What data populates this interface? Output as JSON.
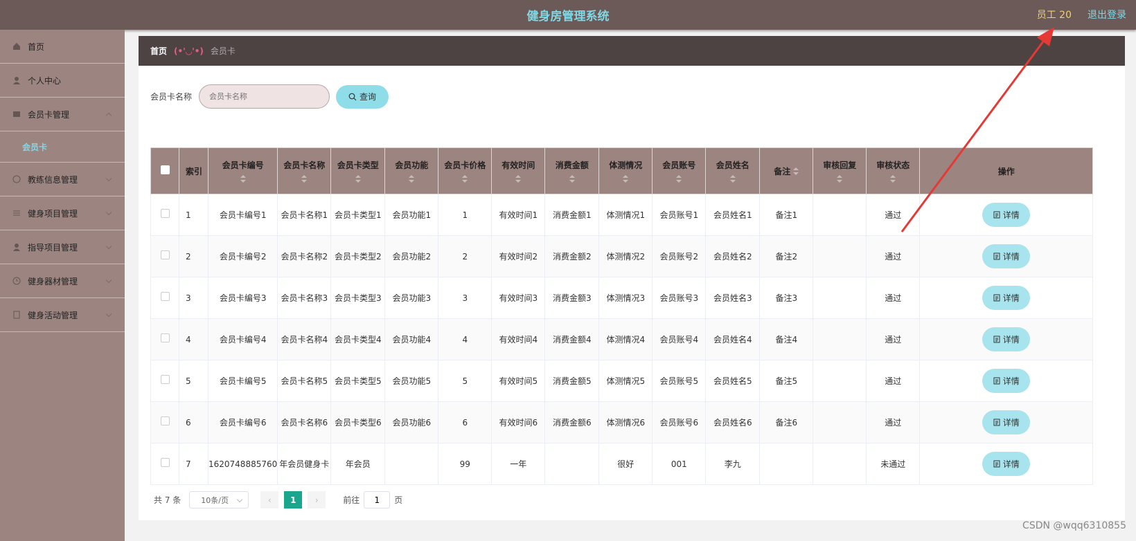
{
  "header": {
    "title": "健身房管理系统",
    "user": "员工 20",
    "logout": "退出登录"
  },
  "sidebar": {
    "items": [
      {
        "label": "首页",
        "icon": "home-icon"
      },
      {
        "label": "个人中心",
        "icon": "user-icon"
      },
      {
        "label": "会员卡管理",
        "icon": "card-icon",
        "open": true,
        "sub": [
          "会员卡"
        ]
      },
      {
        "label": "教练信息管理",
        "icon": "info-icon"
      },
      {
        "label": "健身项目管理",
        "icon": "list-icon"
      },
      {
        "label": "指导项目管理",
        "icon": "user-icon"
      },
      {
        "label": "健身器材管理",
        "icon": "clock-icon"
      },
      {
        "label": "健身活动管理",
        "icon": "doc-icon"
      }
    ]
  },
  "breadcrumb": {
    "home": "首页",
    "face": "(•'◡'•)",
    "current": "会员卡"
  },
  "search": {
    "label": "会员卡名称",
    "placeholder": "会员卡名称",
    "button": "查询"
  },
  "table": {
    "headers": [
      "索引",
      "会员卡编号",
      "会员卡名称",
      "会员卡类型",
      "会员功能",
      "会员卡价格",
      "有效时间",
      "消费金额",
      "体测情况",
      "会员账号",
      "会员姓名",
      "备注",
      "审核回复",
      "审核状态",
      "操作"
    ],
    "rows": [
      [
        "1",
        "会员卡编号1",
        "会员卡名称1",
        "会员卡类型1",
        "会员功能1",
        "1",
        "有效时间1",
        "消费金额1",
        "体测情况1",
        "会员账号1",
        "会员姓名1",
        "备注1",
        "",
        "通过"
      ],
      [
        "2",
        "会员卡编号2",
        "会员卡名称2",
        "会员卡类型2",
        "会员功能2",
        "2",
        "有效时间2",
        "消费金额2",
        "体测情况2",
        "会员账号2",
        "会员姓名2",
        "备注2",
        "",
        "通过"
      ],
      [
        "3",
        "会员卡编号3",
        "会员卡名称3",
        "会员卡类型3",
        "会员功能3",
        "3",
        "有效时间3",
        "消费金额3",
        "体测情况3",
        "会员账号3",
        "会员姓名3",
        "备注3",
        "",
        "通过"
      ],
      [
        "4",
        "会员卡编号4",
        "会员卡名称4",
        "会员卡类型4",
        "会员功能4",
        "4",
        "有效时间4",
        "消费金额4",
        "体测情况4",
        "会员账号4",
        "会员姓名4",
        "备注4",
        "",
        "通过"
      ],
      [
        "5",
        "会员卡编号5",
        "会员卡名称5",
        "会员卡类型5",
        "会员功能5",
        "5",
        "有效时间5",
        "消费金额5",
        "体测情况5",
        "会员账号5",
        "会员姓名5",
        "备注5",
        "",
        "通过"
      ],
      [
        "6",
        "会员卡编号6",
        "会员卡名称6",
        "会员卡类型6",
        "会员功能6",
        "6",
        "有效时间6",
        "消费金额6",
        "体测情况6",
        "会员账号6",
        "会员姓名6",
        "备注6",
        "",
        "通过"
      ],
      [
        "7",
        "1620748885760",
        "年会员健身卡",
        "年会员",
        "",
        "99",
        "一年",
        "",
        "很好",
        "001",
        "李九",
        "",
        "",
        "未通过"
      ]
    ],
    "action_label": "详情"
  },
  "pagination": {
    "total": "共 7 条",
    "page_size": "10条/页",
    "current_page": "1",
    "goto_label": "前往",
    "goto_value": "1",
    "page_unit": "页"
  },
  "watermark": "CSDN @wqq6310855",
  "colors": {
    "topbar": "#6b5a57",
    "sidebar": "#9c8580",
    "accent": "#7fd8e6",
    "page_active": "#1aa58d",
    "annotation": "#e53935"
  }
}
